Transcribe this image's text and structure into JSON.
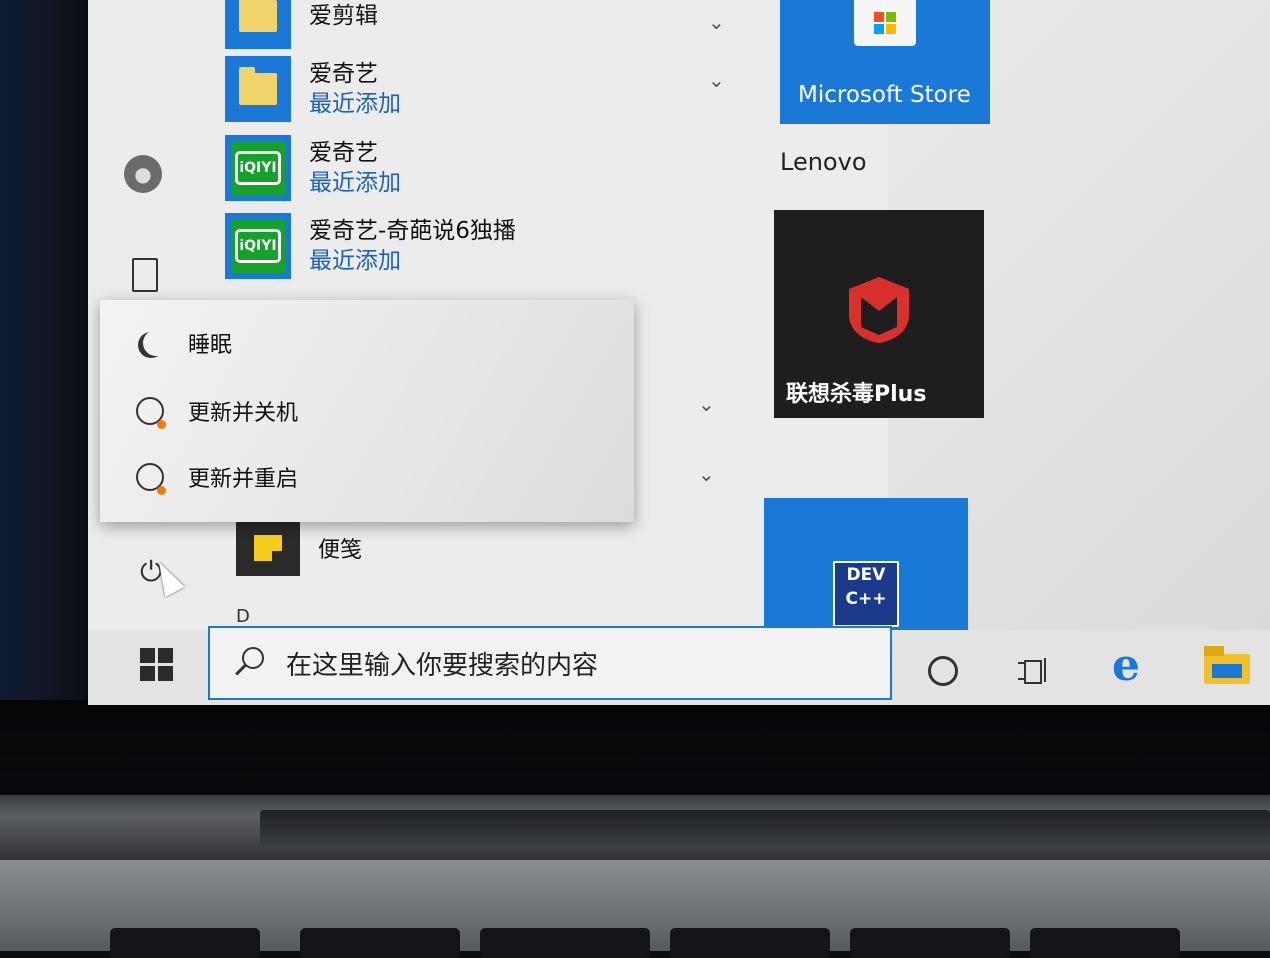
{
  "start_menu": {
    "app_list": [
      {
        "name": "爱剪辑",
        "subtitle": "",
        "icon": "folder-icon"
      },
      {
        "name": "爱奇艺",
        "subtitle": "最近添加",
        "icon": "folder-icon"
      },
      {
        "name": "爱奇艺",
        "subtitle": "最近添加",
        "icon": "iqiyi-icon"
      },
      {
        "name": "爱奇艺-奇葩说6独播",
        "subtitle": "最近添加",
        "icon": "iqiyi-icon"
      }
    ],
    "iqiyi_logo_text": "iQIYI",
    "sticky_notes": {
      "name": "便笺"
    },
    "partial_letter": "D"
  },
  "power_flyout": {
    "items": [
      {
        "label": "睡眠",
        "icon": "moon-icon"
      },
      {
        "label": "更新并关机",
        "icon": "update-shutdown-icon"
      },
      {
        "label": "更新并重启",
        "icon": "update-restart-icon"
      }
    ]
  },
  "tiles": {
    "store": {
      "label": "Microsoft Store"
    },
    "group_label": "Lenovo",
    "mcafee": {
      "label": "联想杀毒Plus"
    },
    "devcpp": {
      "line1": "DEV",
      "line2": "C++"
    }
  },
  "taskbar": {
    "search_placeholder": "在这里输入你要搜索的内容"
  },
  "colors": {
    "accent": "#1a78d6",
    "iqiyi_green": "#16a02c",
    "mcafee_red": "#d9302e",
    "update_dot": "#f07a12"
  }
}
